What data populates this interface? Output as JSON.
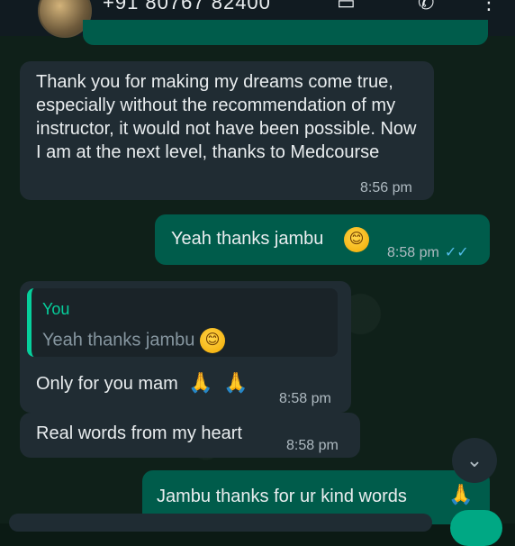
{
  "header": {
    "contact_number": "+91 80767 82400"
  },
  "messages": [
    {
      "text": "Thank you for making my dreams come true, especially without the recommendation of my instructor, it would not have been possible. Now I am at the next level, thanks to Medcourse",
      "time": "8:56 pm"
    },
    {
      "text": "Yeah thanks jambu",
      "time": "8:58 pm",
      "emoji": "😊"
    },
    {
      "reply_to": {
        "author": "You",
        "text": "Yeah thanks jambu",
        "emoji": "😊"
      },
      "text": "Only for you mam",
      "time": "8:58 pm",
      "emojis": [
        "🙏",
        "🙏"
      ]
    },
    {
      "text": "Real words from my heart",
      "time": "8:58 pm"
    },
    {
      "text": "Jambu thanks for ur kind words",
      "emoji": "🙏"
    }
  ],
  "icons": {
    "scroll_down": "chevron-double-down-icon",
    "read_receipt": "double-check-icon"
  },
  "colors": {
    "incoming_bubble": "#202c33",
    "outgoing_bubble": "#005c4b",
    "accent": "#06cf9c",
    "read_tick": "#53bdeb"
  }
}
